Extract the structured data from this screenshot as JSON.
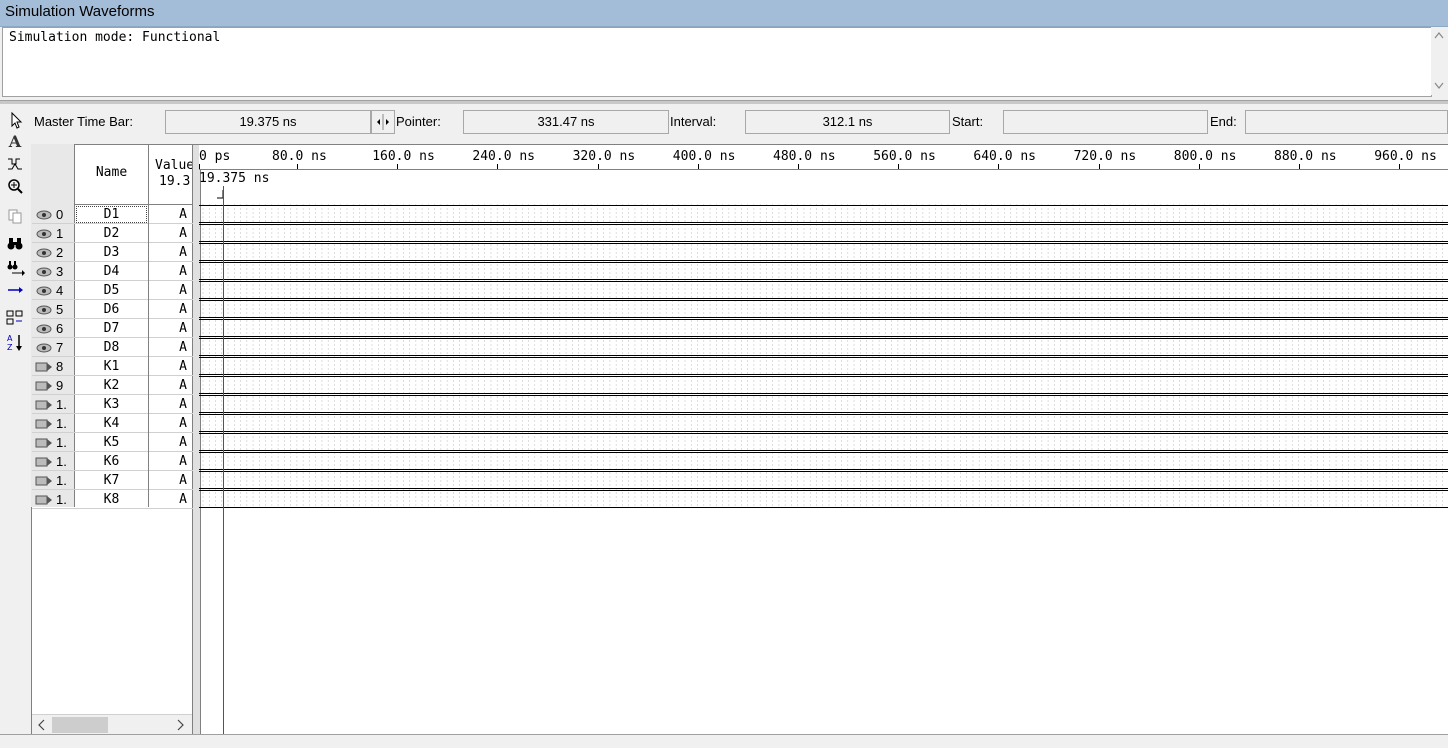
{
  "window": {
    "title": "Simulation Waveforms"
  },
  "messages": {
    "text": "Simulation mode: Functional"
  },
  "timebar": {
    "master_label": "Master Time Bar:",
    "master_value": "19.375 ns",
    "pointer_label": "Pointer:",
    "pointer_value": "331.47 ns",
    "interval_label": "Interval:",
    "interval_value": "312.1 ns",
    "start_label": "Start:",
    "start_value": "",
    "end_label": "End:",
    "end_value": ""
  },
  "table": {
    "name_header": "Name",
    "value_header_1": "Value",
    "value_header_2": "19.3",
    "marker_label": "19.375 ns"
  },
  "time_ticks": [
    "0 ps",
    "80.0 ns",
    "160.0 ns",
    "240.0 ns",
    "320.0 ns",
    "400.0 ns",
    "480.0 ns",
    "560.0 ns",
    "640.0 ns",
    "720.0 ns",
    "800.0 ns",
    "880.0 ns",
    "960.0 ns"
  ],
  "signals": [
    {
      "index": "0",
      "name": "D1",
      "value": "A",
      "type": "output-icon"
    },
    {
      "index": "1",
      "name": "D2",
      "value": "A",
      "type": "output-icon"
    },
    {
      "index": "2",
      "name": "D3",
      "value": "A",
      "type": "output-icon"
    },
    {
      "index": "3",
      "name": "D4",
      "value": "A",
      "type": "output-icon"
    },
    {
      "index": "4",
      "name": "D5",
      "value": "A",
      "type": "output-icon"
    },
    {
      "index": "5",
      "name": "D6",
      "value": "A",
      "type": "output-icon"
    },
    {
      "index": "6",
      "name": "D7",
      "value": "A",
      "type": "output-icon"
    },
    {
      "index": "7",
      "name": "D8",
      "value": "A",
      "type": "output-icon"
    },
    {
      "index": "8",
      "name": "K1",
      "value": "A",
      "type": "input-icon"
    },
    {
      "index": "9",
      "name": "K2",
      "value": "A",
      "type": "input-icon"
    },
    {
      "index": "1.",
      "name": "K3",
      "value": "A",
      "type": "input-icon"
    },
    {
      "index": "1.",
      "name": "K4",
      "value": "A",
      "type": "input-icon"
    },
    {
      "index": "1.",
      "name": "K5",
      "value": "A",
      "type": "input-icon"
    },
    {
      "index": "1.",
      "name": "K6",
      "value": "A",
      "type": "input-icon"
    },
    {
      "index": "1.",
      "name": "K7",
      "value": "A",
      "type": "input-icon"
    },
    {
      "index": "1.",
      "name": "K8",
      "value": "A",
      "type": "input-icon"
    }
  ],
  "tools": [
    "selection-arrow-icon",
    "text-tool-icon",
    "waveform-editing-icon",
    "zoom-icon",
    "copy-icon",
    "find-icon",
    "replace-icon",
    "arrow-right-icon",
    "group-icon",
    "sort-icon"
  ],
  "colors": {
    "titlebar": "#a3bcd8",
    "marker": "#4a4aa0"
  }
}
